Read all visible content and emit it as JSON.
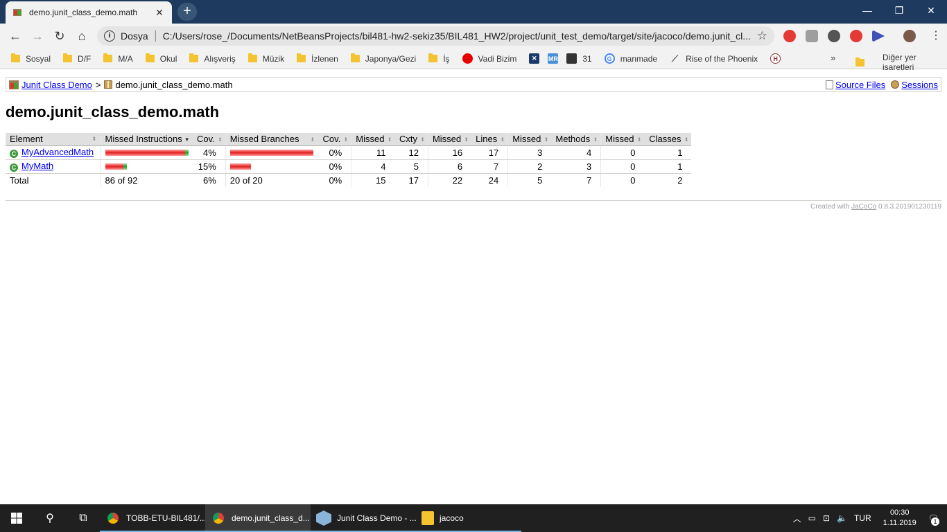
{
  "browser": {
    "tab_title": "demo.junit_class_demo.math",
    "new_tab_symbol": "+",
    "omnibox_protocol": "Dosya",
    "url": "C:/Users/rose_/Documents/NetBeansProjects/bil481-hw2-sekiz35/BIL481_HW2/project/unit_test_demo/target/site/jacoco/demo.junit_cl..."
  },
  "bookmarks": [
    {
      "label": "Sosyal",
      "type": "folder"
    },
    {
      "label": "D/F",
      "type": "folder"
    },
    {
      "label": "M/A",
      "type": "folder"
    },
    {
      "label": "Okul",
      "type": "folder"
    },
    {
      "label": "Alışveriş",
      "type": "folder"
    },
    {
      "label": "Müzik",
      "type": "folder"
    },
    {
      "label": "İzlenen",
      "type": "folder"
    },
    {
      "label": "Japonya/Gezi",
      "type": "folder"
    },
    {
      "label": "İş",
      "type": "folder"
    },
    {
      "label": "Vadi Bizim",
      "type": "site",
      "icon": "vodafone-icon",
      "color": "#e60000"
    },
    {
      "label": "",
      "type": "site",
      "icon": "x-icon",
      "color": "#1a3a6a"
    },
    {
      "label": "",
      "type": "site",
      "icon": "mr-icon",
      "color": "#4a90d9"
    },
    {
      "label": "31",
      "type": "site",
      "icon": "epic-icon",
      "color": "#333333"
    },
    {
      "label": "manmade",
      "type": "site",
      "icon": "google-icon",
      "color": "#4285f4"
    },
    {
      "label": "Rise of the Phoenix",
      "type": "site",
      "icon": "feather-icon",
      "color": "#555555"
    },
    {
      "label": "",
      "type": "site",
      "icon": "h-icon",
      "color": "#8a3030"
    }
  ],
  "bookmarks_more": "»",
  "bookmarks_other": "Diğer yer işaretleri",
  "breadcrumb": {
    "root": "Junit Class Demo",
    "separator": ">",
    "current": "demo.junit_class_demo.math",
    "source_files": "Source Files",
    "sessions": "Sessions"
  },
  "page_title": "demo.junit_class_demo.math",
  "table": {
    "headers": [
      "Element",
      "Missed Instructions",
      "Cov.",
      "Missed Branches",
      "Cov.",
      "Missed",
      "Cxty",
      "Missed",
      "Lines",
      "Missed",
      "Methods",
      "Missed",
      "Classes"
    ],
    "rows": [
      {
        "element": "MyAdvancedMath",
        "instr_missed_fraction": 0.96,
        "instr_cov": "4%",
        "branch_missed_fraction": 1.0,
        "branch_cov": "0%",
        "cxty_missed": "11",
        "cxty": "12",
        "lines_missed": "16",
        "lines": "17",
        "methods_missed": "3",
        "methods": "4",
        "classes_missed": "0",
        "classes": "1"
      },
      {
        "element": "MyMath",
        "instr_missed_fraction": 0.85,
        "instr_cov": "15%",
        "branch_missed_fraction": 1.0,
        "branch_cov": "0%",
        "cxty_missed": "4",
        "cxty": "5",
        "lines_missed": "6",
        "lines": "7",
        "methods_missed": "2",
        "methods": "3",
        "classes_missed": "0",
        "classes": "1"
      }
    ],
    "total": {
      "label": "Total",
      "instr": "86 of 92",
      "instr_cov": "6%",
      "branch": "20 of 20",
      "branch_cov": "0%",
      "cxty_missed": "15",
      "cxty": "17",
      "lines_missed": "22",
      "lines": "24",
      "methods_missed": "5",
      "methods": "7",
      "classes_missed": "0",
      "classes": "2"
    }
  },
  "footer": {
    "prefix": "Created with",
    "link": "JaCoCo",
    "version": "0.8.3.201901230119"
  },
  "taskbar": {
    "apps": [
      {
        "label": "TOBB-ETU-BIL481/...",
        "icon": "chrome-icon",
        "active": false
      },
      {
        "label": "demo.junit_class_d...",
        "icon": "chrome-icon",
        "active": true
      },
      {
        "label": "Junit Class Demo - ...",
        "icon": "netbeans-icon",
        "active": false
      },
      {
        "label": "jacoco",
        "icon": "folder-icon",
        "active": false
      }
    ],
    "language": "TUR",
    "time": "00:30",
    "date": "1.11.2019",
    "notification_count": "1"
  },
  "colors": {
    "titlebar": "#1e3a5f",
    "bar_missed": "#e02020",
    "bar_covered": "#1fa01f",
    "link": "#0000ee"
  }
}
